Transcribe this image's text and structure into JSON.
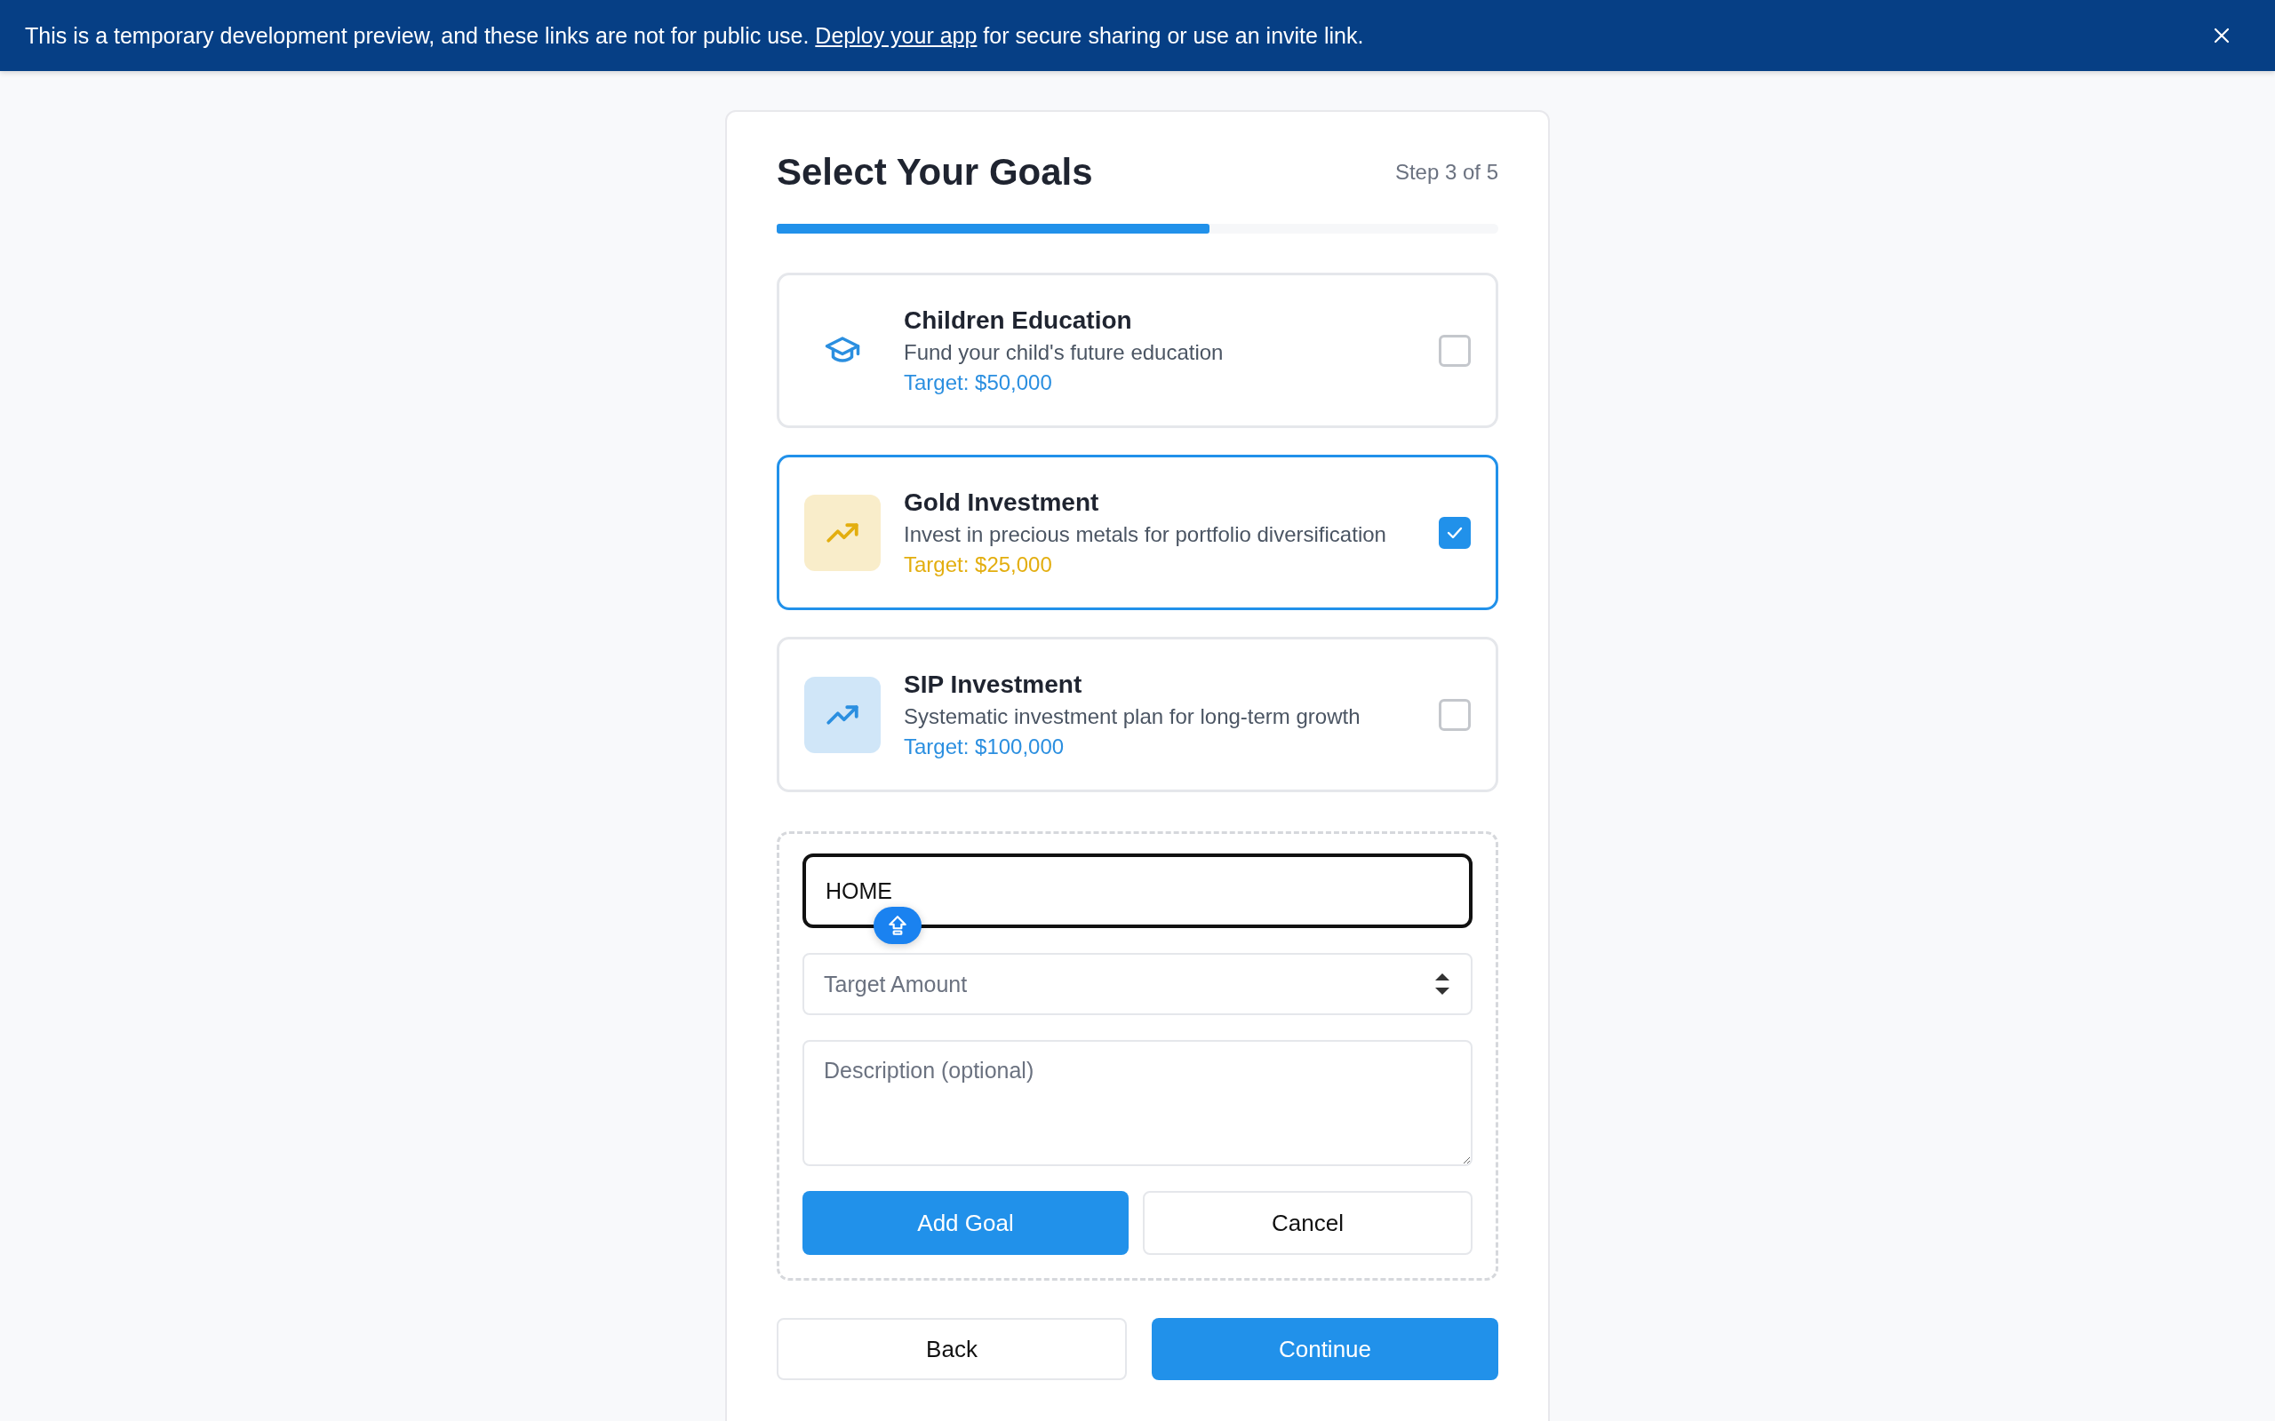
{
  "banner": {
    "text_before": "This is a temporary development preview, and these links are not for public use. ",
    "link": "Deploy your app",
    "text_after": " for secure sharing or use an invite link."
  },
  "header": {
    "title": "Select Your Goals",
    "step": "Step 3 of 5"
  },
  "progress": {
    "level": 0.6
  },
  "goals": [
    {
      "kind": "education",
      "title": "Children Education",
      "description": "Fund your child's future education",
      "target": "Target: $50,000",
      "color": "#2b8fe0",
      "selected": false
    },
    {
      "kind": "trend",
      "title": "Gold Investment",
      "description": "Invest in precious metals for portfolio diversification",
      "target": "Target: $25,000",
      "color": "#e3ae0f",
      "selected": true
    },
    {
      "kind": "trend",
      "title": "SIP Investment",
      "description": "Systematic investment plan for long-term growth",
      "target": "Target: $100,000",
      "color": "#2b8fe0",
      "selected": false
    }
  ],
  "new_goal_form": {
    "name": {
      "value": "HOME"
    },
    "amount": {
      "placeholder": "Target Amount"
    },
    "description": {
      "placeholder": "Description (optional)"
    },
    "add_button": "Add Goal",
    "cancel_button": "Cancel"
  },
  "nav": {
    "back": "Back",
    "continue": "Continue"
  }
}
